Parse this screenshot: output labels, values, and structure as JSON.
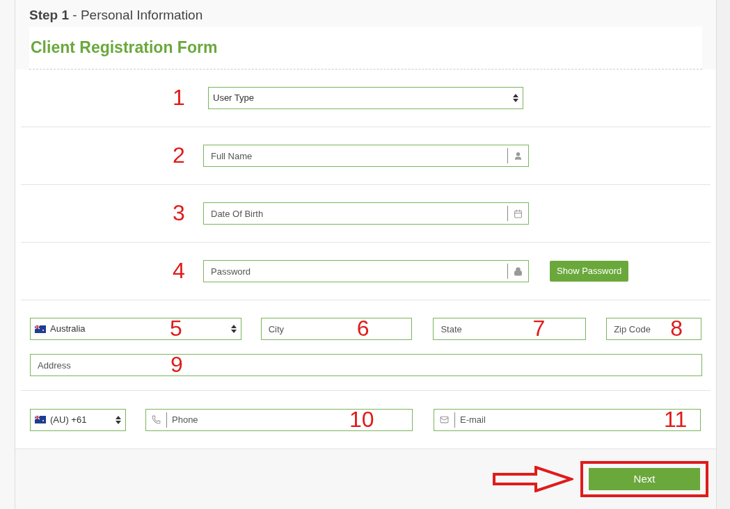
{
  "header": {
    "step": "Step 1",
    "title": "- Personal Information"
  },
  "form_title": "Client Registration Form",
  "rows": [
    {
      "number": "1",
      "kind": "select",
      "placeholder": "User Type"
    },
    {
      "number": "2",
      "kind": "name",
      "placeholder": "Full Name"
    },
    {
      "number": "3",
      "kind": "date",
      "placeholder": "Date Of Birth"
    },
    {
      "number": "4",
      "kind": "password",
      "placeholder": "Password",
      "button": "Show Password"
    }
  ],
  "address": [
    {
      "number": "5",
      "kind": "country",
      "value": "Australia"
    },
    {
      "number": "6",
      "kind": "text",
      "placeholder": "City"
    },
    {
      "number": "7",
      "kind": "text",
      "placeholder": "State"
    },
    {
      "number": "8",
      "kind": "text",
      "placeholder": "Zip Code"
    },
    {
      "number": "9",
      "kind": "text",
      "placeholder": "Address"
    }
  ],
  "contact": [
    {
      "kind": "code",
      "value": "(AU) +61"
    },
    {
      "number": "10",
      "kind": "phone",
      "placeholder": "Phone"
    },
    {
      "number": "11",
      "kind": "email",
      "placeholder": "E-mail"
    }
  ],
  "next_button": "Next"
}
